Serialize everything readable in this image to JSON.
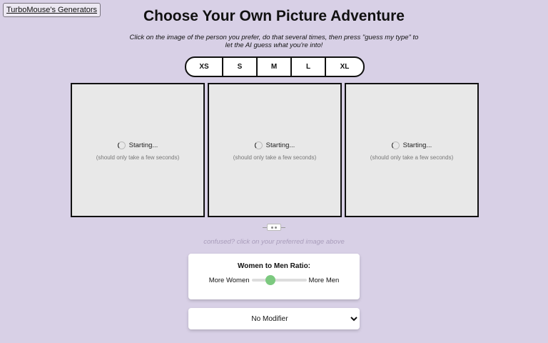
{
  "header": {
    "generators_link": "TurboMouse's Generators",
    "title": "Choose Your Own Picture Adventure",
    "subtitle": "Click on the image of the person you prefer, do that several times, then press \"guess my type\" to let the AI guess what you're into!"
  },
  "sizes": [
    "XS",
    "S",
    "M",
    "L",
    "XL"
  ],
  "panels": [
    {
      "status": "Starting...",
      "note": "(should only take a few seconds)"
    },
    {
      "status": "Starting...",
      "note": "(should only take a few seconds)"
    },
    {
      "status": "Starting...",
      "note": "(should only take a few seconds)"
    }
  ],
  "hint": "confused? click on your preferred image above",
  "ratio": {
    "title": "Women to Men Ratio:",
    "left_label": "More Women",
    "right_label": "More Men",
    "value": 0.35,
    "thumb_color": "#7cc97f"
  },
  "modifier": {
    "selected": "No Modifier"
  }
}
